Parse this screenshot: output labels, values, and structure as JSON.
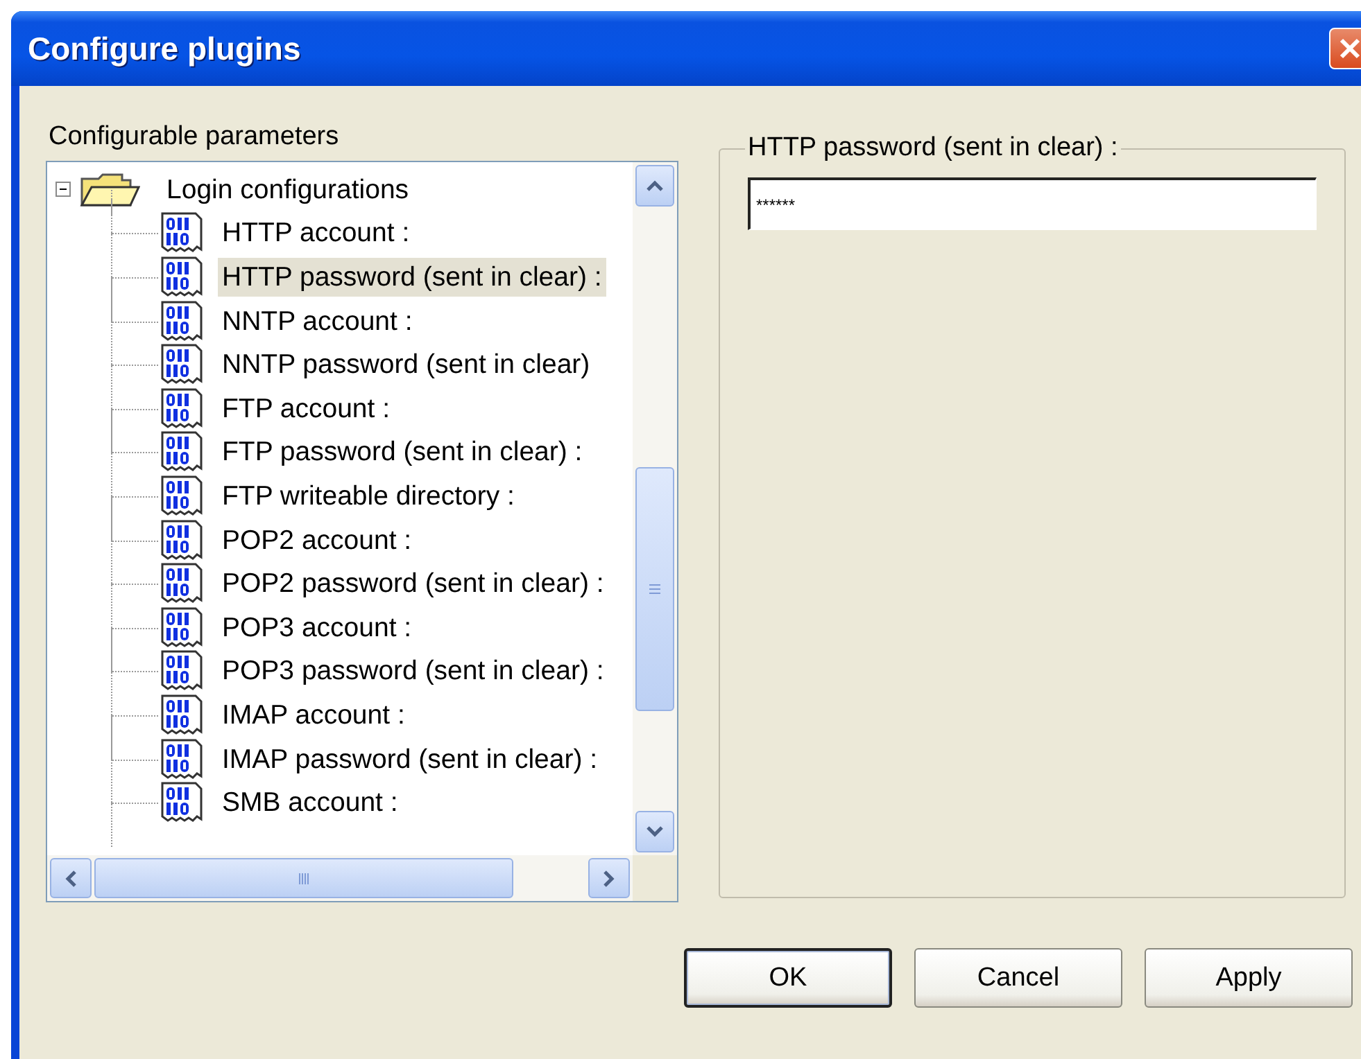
{
  "window": {
    "title": "Configure plugins"
  },
  "tree": {
    "label": "Configurable parameters",
    "nodes": [
      {
        "label": "Login configurations",
        "expanded": true,
        "children": [
          {
            "label": "HTTP account :",
            "selected": false
          },
          {
            "label": "HTTP password (sent in clear) :",
            "selected": true
          },
          {
            "label": "NNTP account :",
            "selected": false
          },
          {
            "label": "NNTP password (sent in clear)",
            "selected": false
          },
          {
            "label": "FTP account :",
            "selected": false
          },
          {
            "label": "FTP password (sent in clear) :",
            "selected": false
          },
          {
            "label": "FTP writeable directory :",
            "selected": false
          },
          {
            "label": "POP2 account :",
            "selected": false
          },
          {
            "label": "POP2 password (sent in clear) :",
            "selected": false
          },
          {
            "label": "POP3 account :",
            "selected": false
          },
          {
            "label": "POP3 password (sent in clear) :",
            "selected": false
          },
          {
            "label": "IMAP account :",
            "selected": false
          },
          {
            "label": "IMAP password (sent in clear) :",
            "selected": false
          },
          {
            "label": "SMB account :",
            "selected": false
          }
        ]
      }
    ]
  },
  "editor": {
    "label": "HTTP password (sent in clear) :",
    "value": "******"
  },
  "buttons": [
    {
      "label": "OK",
      "default": true
    },
    {
      "label": "Cancel",
      "default": false
    },
    {
      "label": "Apply",
      "default": false
    }
  ]
}
